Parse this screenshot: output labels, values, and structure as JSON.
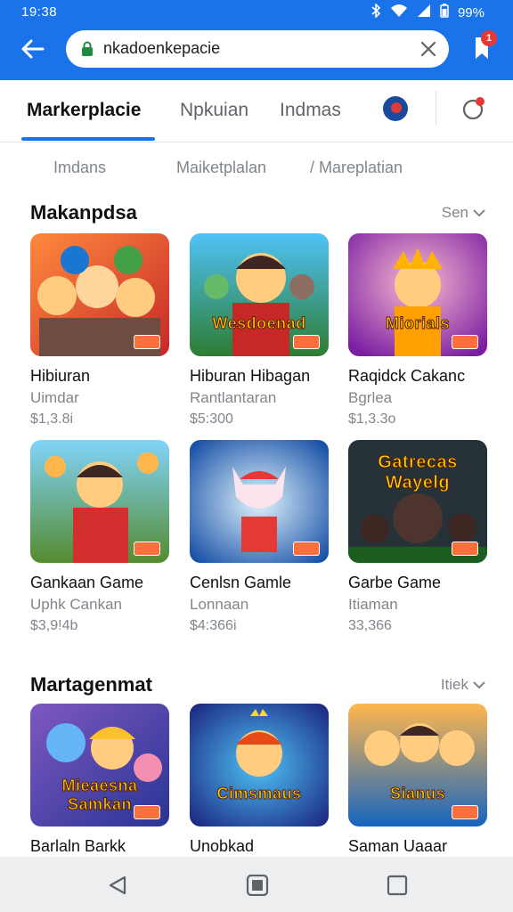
{
  "status": {
    "time": "19:38",
    "battery": "99%"
  },
  "browser": {
    "url": "nkadoenkepacie",
    "notif_count": "1"
  },
  "tabs": [
    {
      "label": "Markerplacie"
    },
    {
      "label": "Npkuian"
    },
    {
      "label": "Indmas"
    }
  ],
  "subtabs": [
    {
      "label": "Imdans"
    },
    {
      "label": "Maiketplalan"
    },
    {
      "label": "/ Mareplatian"
    }
  ],
  "sections": [
    {
      "title": "Makanpdsa",
      "more": "Sen",
      "cards": [
        {
          "title": "Hibiuran",
          "sub": "Uimdar",
          "price": "$1,3.8i"
        },
        {
          "title": "Hiburan Hibagan",
          "sub": "Rantlantaran",
          "price": "$5:300"
        },
        {
          "title": "Raqidck Cakanc",
          "sub": "Bgrlea",
          "price": "$1,3.3o"
        },
        {
          "title": "Gankaan Game",
          "sub": "Uphk Cankan",
          "price": "$3,9!4b"
        },
        {
          "title": "Cenlsn Gamle",
          "sub": "Lonnaan",
          "price": "$4:366i"
        },
        {
          "title": "Garbe Game",
          "sub": "Itiaman",
          "price": "33,366"
        }
      ]
    },
    {
      "title": "Martagenmat",
      "more": "Itiek",
      "cards": [
        {
          "title": "Barlaln Barkk",
          "banner": "Mieaesna Samkan"
        },
        {
          "title": "Unobkad",
          "banner": "Cimsmaus"
        },
        {
          "title": "Saman Uaaar",
          "banner": "Sianus"
        }
      ]
    }
  ],
  "thumb_banners": {
    "c1_2": "Wesdoenad",
    "c1_3": "Miorials",
    "c2_3": "Gatrecas Wayelg"
  },
  "colors": {
    "accent": "#1a73e8",
    "badge": "#e53935",
    "nav_bg": "#eceef0"
  }
}
